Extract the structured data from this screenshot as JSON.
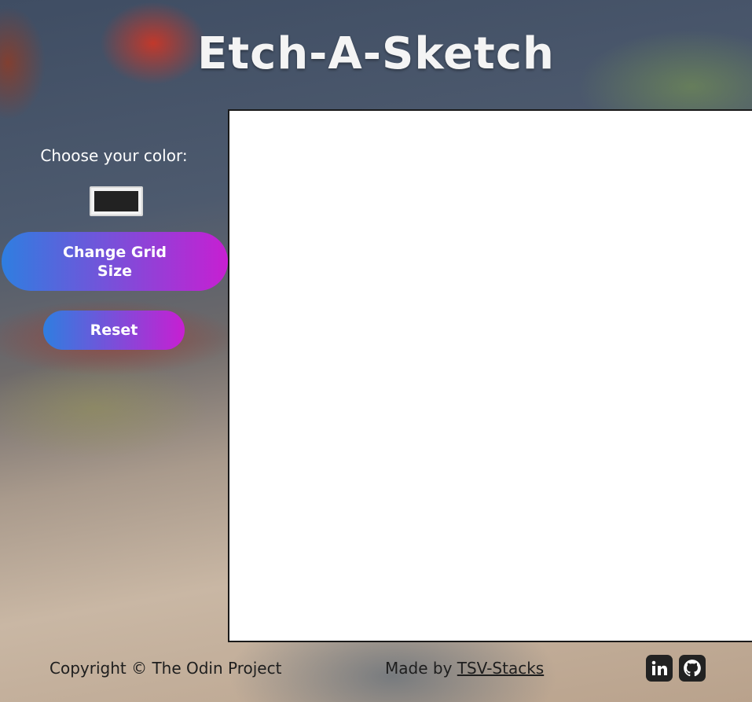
{
  "header": {
    "title": "Etch-A-Sketch"
  },
  "sidebar": {
    "color_label": "Choose your color:",
    "color_value": "#222222",
    "grid_button_label": "Change Grid Size",
    "reset_button_label": "Reset"
  },
  "footer": {
    "copyright": "Copyright © The Odin Project",
    "made_by_prefix": "Made by",
    "made_by_link": "TSV-Stacks",
    "social_icons": [
      "linkedin-icon",
      "github-icon"
    ]
  },
  "colors": {
    "button_gradient_start": "#2f7ee0",
    "button_gradient_end": "#c71fd2",
    "canvas": "#ffffff",
    "footer_icon": "#222222"
  }
}
